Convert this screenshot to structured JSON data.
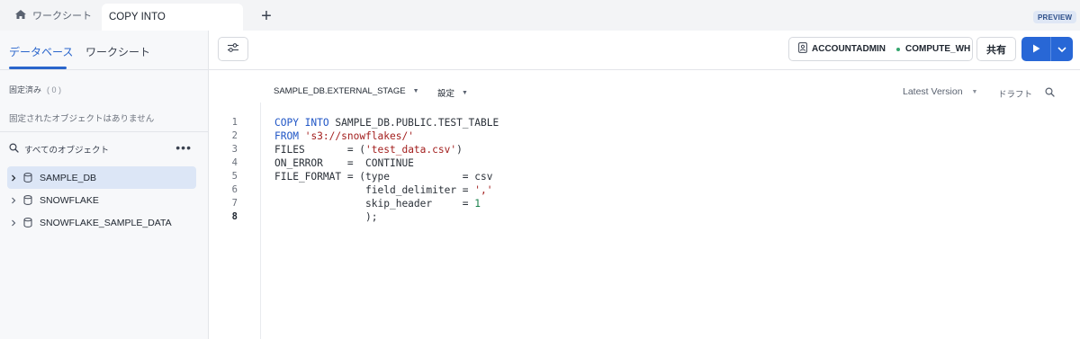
{
  "tabs": {
    "home_label": "ワークシート",
    "active_label": "COPY INTO",
    "add_label": "+",
    "preview_badge": "PREVIEW"
  },
  "sidebar": {
    "tabs": [
      "データベース",
      "ワークシート"
    ],
    "active_tab": 0,
    "pinned_label": "固定済み",
    "pinned_count": "( 0 )",
    "pinned_empty": "固定されたオブジェクトはありません",
    "search_label": "すべてのオブジェクト",
    "more_label": "•••",
    "items": [
      {
        "name": "SAMPLE_DB",
        "selected": true
      },
      {
        "name": "SNOWFLAKE",
        "selected": false
      },
      {
        "name": "SNOWFLAKE_SAMPLE_DATA",
        "selected": false
      }
    ]
  },
  "toolbar": {
    "role": "ACCOUNTADMIN",
    "warehouse": "COMPUTE_WH",
    "share_label": "共有"
  },
  "editor": {
    "context_label": "SAMPLE_DB.EXTERNAL_STAGE",
    "settings_label": "設定",
    "version_label": "Latest Version",
    "draft_label": "ドラフト",
    "current_line": 8,
    "lines": [
      {
        "n": "1",
        "segs": [
          {
            "t": "COPY INTO",
            "c": "kw"
          },
          {
            "t": " SAMPLE_DB.PUBLIC.TEST_TABLE",
            "c": ""
          }
        ]
      },
      {
        "n": "2",
        "segs": [
          {
            "t": "FROM",
            "c": "kw"
          },
          {
            "t": " ",
            "c": ""
          },
          {
            "t": "'s3://snowflakes/'",
            "c": "str"
          }
        ]
      },
      {
        "n": "3",
        "segs": [
          {
            "t": "FILES       = (",
            "c": ""
          },
          {
            "t": "'test_data.csv'",
            "c": "str"
          },
          {
            "t": ")",
            "c": ""
          }
        ]
      },
      {
        "n": "4",
        "segs": [
          {
            "t": "ON_ERROR    =  CONTINUE",
            "c": ""
          }
        ]
      },
      {
        "n": "5",
        "segs": [
          {
            "t": "FILE_FORMAT = (type            = csv",
            "c": ""
          }
        ]
      },
      {
        "n": "6",
        "segs": [
          {
            "t": "               field_delimiter = ",
            "c": ""
          },
          {
            "t": "','",
            "c": "str"
          }
        ]
      },
      {
        "n": "7",
        "segs": [
          {
            "t": "               skip_header     = ",
            "c": ""
          },
          {
            "t": "1",
            "c": "num"
          }
        ]
      },
      {
        "n": "8",
        "segs": [
          {
            "t": "               );",
            "c": ""
          }
        ]
      }
    ]
  },
  "colors": {
    "accent": "#2965cc",
    "run_button": "#2867d6",
    "keyword": "#2056c6",
    "string": "#a3201f",
    "number": "#18804a",
    "status_dot": "#35a66e"
  }
}
